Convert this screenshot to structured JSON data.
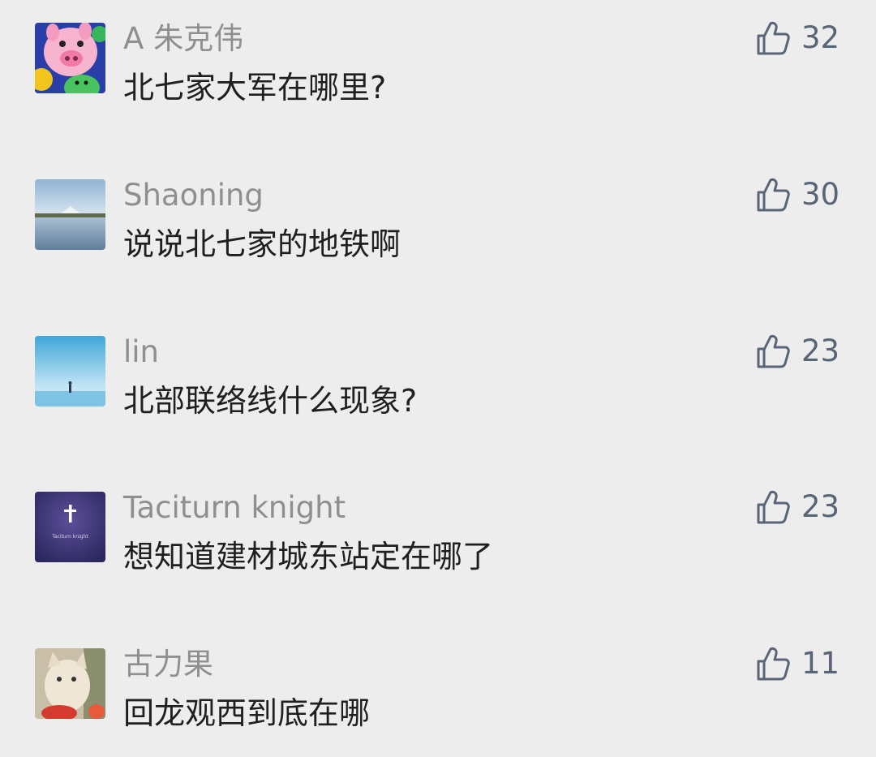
{
  "comments": [
    {
      "username": "A 朱克伟",
      "text": "北七家大军在哪里?",
      "likes": "32",
      "avatar": "pig-avatar-image"
    },
    {
      "username": "Shaoning",
      "text": "说说北七家的地铁啊",
      "likes": "30",
      "avatar": "lake-landscape-avatar-image"
    },
    {
      "username": "lin",
      "text": "北部联络线什么现象?",
      "likes": "23",
      "avatar": "sky-figure-avatar-image"
    },
    {
      "username": "Taciturn knight",
      "text": "想知道建材城东站定在哪了",
      "likes": "23",
      "avatar": "cross-avatar-image",
      "avatar_caption": "Taciturn knight"
    },
    {
      "username": "古力果",
      "text": "回龙观西到底在哪",
      "likes": "11",
      "avatar": "cat-avatar-image"
    }
  ],
  "icons": {
    "like": "thumbs-up-icon"
  },
  "colors": {
    "background": "#ededed",
    "username": "#8f8f8f",
    "comment_text": "#1f1f1f",
    "like": "#5a6477"
  }
}
